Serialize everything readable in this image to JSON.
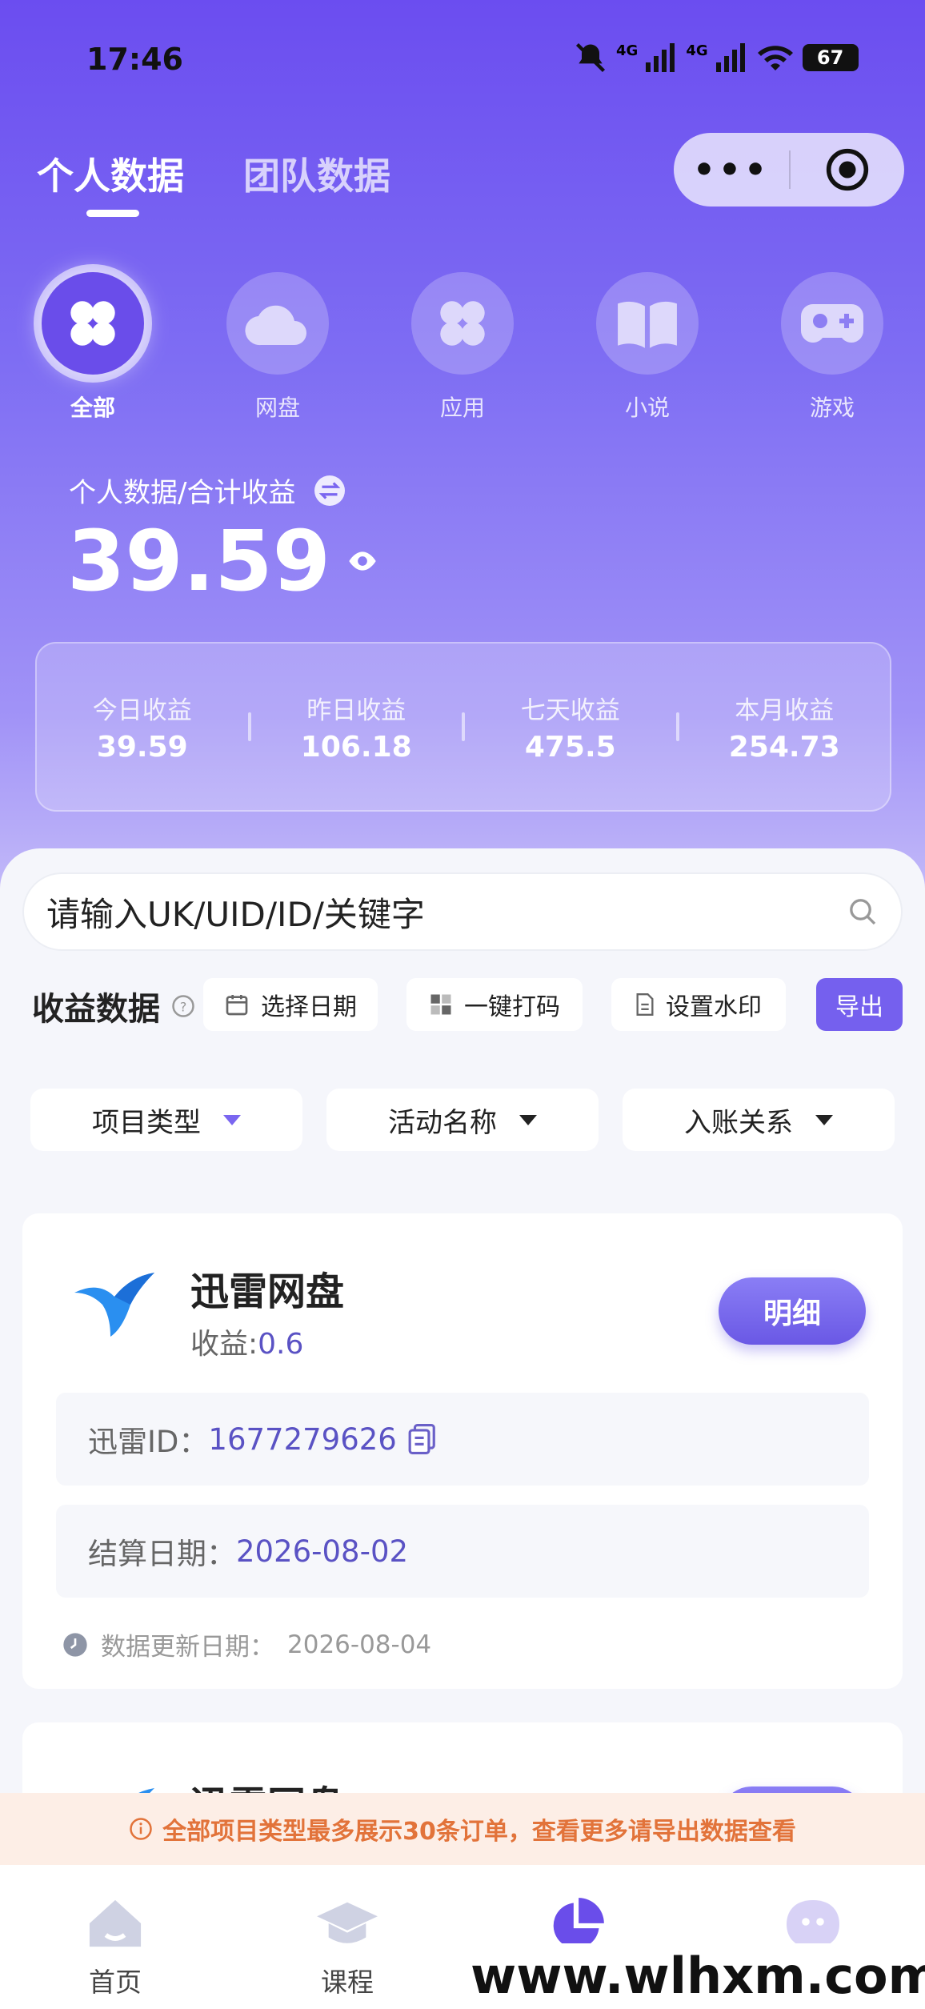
{
  "status_bar": {
    "time": "17:46",
    "net1": "4G",
    "net2": "4G",
    "battery": "67"
  },
  "header": {
    "tabs": [
      {
        "label": "个人数据",
        "active": true
      },
      {
        "label": "团队数据",
        "active": false
      }
    ]
  },
  "categories": [
    {
      "label": "全部",
      "icon": "grid-four-icon",
      "active": true
    },
    {
      "label": "网盘",
      "icon": "cloud-icon",
      "active": false
    },
    {
      "label": "应用",
      "icon": "grid-four-icon",
      "active": false
    },
    {
      "label": "小说",
      "icon": "book-icon",
      "active": false
    },
    {
      "label": "游戏",
      "icon": "gamepad-icon",
      "active": false
    }
  ],
  "summary": {
    "title": "个人数据/合计收益",
    "total": "39.59"
  },
  "stats": [
    {
      "label": "今日收益",
      "value": "39.59"
    },
    {
      "label": "昨日收益",
      "value": "106.18"
    },
    {
      "label": "七天收益",
      "value": "475.5"
    },
    {
      "label": "本月收益",
      "value": "254.73"
    }
  ],
  "search": {
    "placeholder": "请输入UK/UID/ID/关键字"
  },
  "toolbar": {
    "title": "收益数据",
    "date_label": "选择日期",
    "mask_label": "一键打码",
    "watermark_label": "设置水印",
    "export_label": "导出"
  },
  "filters": [
    "项目类型",
    "活动名称",
    "入账关系"
  ],
  "cards": [
    {
      "name": "迅雷网盘",
      "income_label": "收益:",
      "income_value": "0.6",
      "detail_label": "明细",
      "id_label": "迅雷ID：",
      "id_value": "1677279626",
      "settle_label": "结算日期：",
      "settle_value": "2026-08-02",
      "update_label": "数据更新日期：",
      "update_value": "2026-08-04"
    },
    {
      "name": "迅雷网盘"
    }
  ],
  "notice": {
    "text": "全部项目类型最多展示30条订单，查看更多请导出数据查看"
  },
  "bottom_nav": [
    "首页",
    "课程",
    "",
    ""
  ],
  "watermark_text": "www.wlhxm.com",
  "colors": {
    "primary": "#6b4df0",
    "accent_text": "#5a52c4",
    "notice": "#e2733a"
  }
}
